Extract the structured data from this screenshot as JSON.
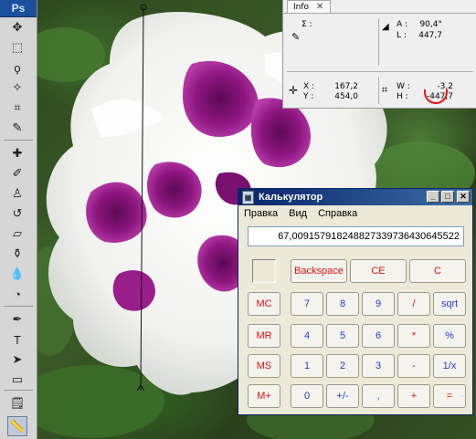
{
  "app": {
    "logo": "Ps"
  },
  "toolbox": {
    "tools": [
      {
        "name": "move-tool",
        "glyph": "✥"
      },
      {
        "name": "marquee-tool",
        "glyph": "⬚"
      },
      {
        "name": "lasso-tool",
        "glyph": "ϙ"
      },
      {
        "name": "magic-wand-tool",
        "glyph": "✧"
      },
      {
        "name": "crop-tool",
        "glyph": "⌗"
      },
      {
        "name": "eyedropper-tool",
        "glyph": "✎"
      },
      {
        "name": "healing-brush-tool",
        "glyph": "✚"
      },
      {
        "name": "brush-tool",
        "glyph": "✐"
      },
      {
        "name": "clone-stamp-tool",
        "glyph": "♙"
      },
      {
        "name": "history-brush-tool",
        "glyph": "↺"
      },
      {
        "name": "eraser-tool",
        "glyph": "▱"
      },
      {
        "name": "paint-bucket-tool",
        "glyph": "⚱"
      },
      {
        "name": "blur-tool",
        "glyph": "💧"
      },
      {
        "name": "dodge-tool",
        "glyph": "◔"
      },
      {
        "name": "pen-tool",
        "glyph": "✒"
      },
      {
        "name": "type-tool",
        "glyph": "T"
      },
      {
        "name": "path-selection-tool",
        "glyph": "➤"
      },
      {
        "name": "rectangle-tool",
        "glyph": "▭"
      },
      {
        "name": "notes-tool",
        "glyph": "🗒"
      },
      {
        "name": "ruler-tool",
        "glyph": "📏"
      }
    ]
  },
  "info_panel": {
    "tab_label": "Info",
    "close_glyph": "✕",
    "sigma_label": "Σ :",
    "angle_label": "A :",
    "angle_value": "90,4°",
    "length_label": "L :",
    "length_value": "447,7",
    "x_label": "X :",
    "x_value": "167,2",
    "y_label": "Y :",
    "y_value": "454,0",
    "w_label": "W :",
    "w_value": "-3,2",
    "h_label": "H :",
    "h_value": "-447,7",
    "highlight_color": "#e11111"
  },
  "calculator": {
    "title": "Калькулятор",
    "menu": [
      "Правка",
      "Вид",
      "Справка"
    ],
    "display": "67,00915791824882733973643064552​2",
    "buttons": {
      "backspace": "Backspace",
      "ce": "CE",
      "c": "C",
      "mc": "MC",
      "mr": "MR",
      "ms": "MS",
      "mplus": "M+",
      "7": "7",
      "8": "8",
      "9": "9",
      "div": "/",
      "sqrt": "sqrt",
      "4": "4",
      "5": "5",
      "6": "6",
      "mul": "*",
      "pct": "%",
      "1": "1",
      "2": "2",
      "3": "3",
      "sub": "-",
      "inv": "1/x",
      "0": "0",
      "neg": "+/-",
      "dot": ",",
      "add": "+",
      "eq": "="
    },
    "colors": {
      "title_bar": "#0a246a",
      "red_keys": "#e01010",
      "blue_keys": "#1f3fd0"
    }
  }
}
